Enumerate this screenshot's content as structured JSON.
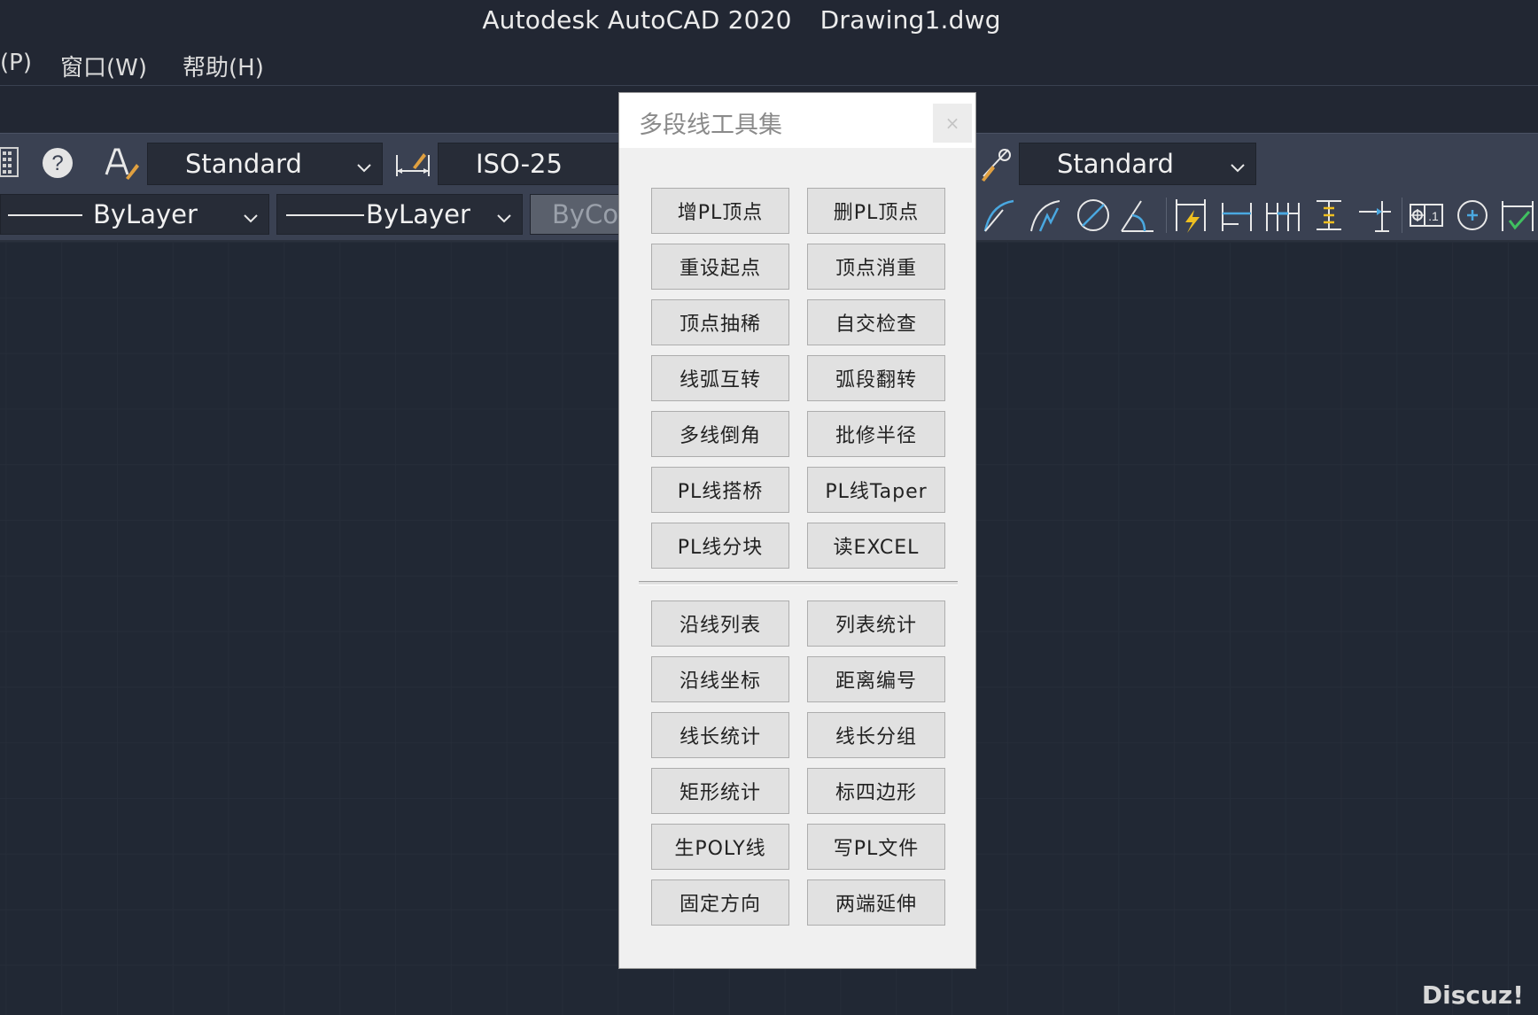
{
  "window": {
    "app_title": "Autodesk AutoCAD 2020",
    "document": "Drawing1.dwg"
  },
  "menu": {
    "items": [
      "(P)",
      "窗口(W)",
      "帮助(H)"
    ]
  },
  "toolbar": {
    "text_style": "Standard",
    "dim_style": "ISO-25",
    "table_style": "Standard",
    "linetype": "ByLayer",
    "lineweight": "ByLayer",
    "plotstyle": "ByColor",
    "help_glyph": "?",
    "icons": [
      "calculator-icon",
      "help-icon",
      "text-style-icon",
      "dim-style-icon",
      "table-style-icon",
      "dim-arc-length-icon",
      "dim-jogged-icon",
      "dim-diameter-icon",
      "dim-angular-icon",
      "dim-quick-icon",
      "dim-baseline-icon",
      "dim-continue-icon",
      "dim-space-icon",
      "dim-break-icon",
      "tolerance-icon",
      "center-mark-icon",
      "inspect-icon"
    ]
  },
  "dialog": {
    "title": "多段线工具集",
    "close_glyph": "×",
    "group1": [
      "增PL顶点",
      "删PL顶点",
      "重设起点",
      "顶点消重",
      "顶点抽稀",
      "自交检查",
      "线弧互转",
      "弧段翻转",
      "多线倒角",
      "批修半径",
      "PL线搭桥",
      "PL线Taper",
      "PL线分块",
      "读EXCEL"
    ],
    "group2": [
      "沿线列表",
      "列表统计",
      "沿线坐标",
      "距离编号",
      "线长统计",
      "线长分组",
      "矩形统计",
      "标四边形",
      "生POLY线",
      "写PL文件",
      "固定方向",
      "两端延伸"
    ]
  },
  "watermark": "Discuz!"
}
